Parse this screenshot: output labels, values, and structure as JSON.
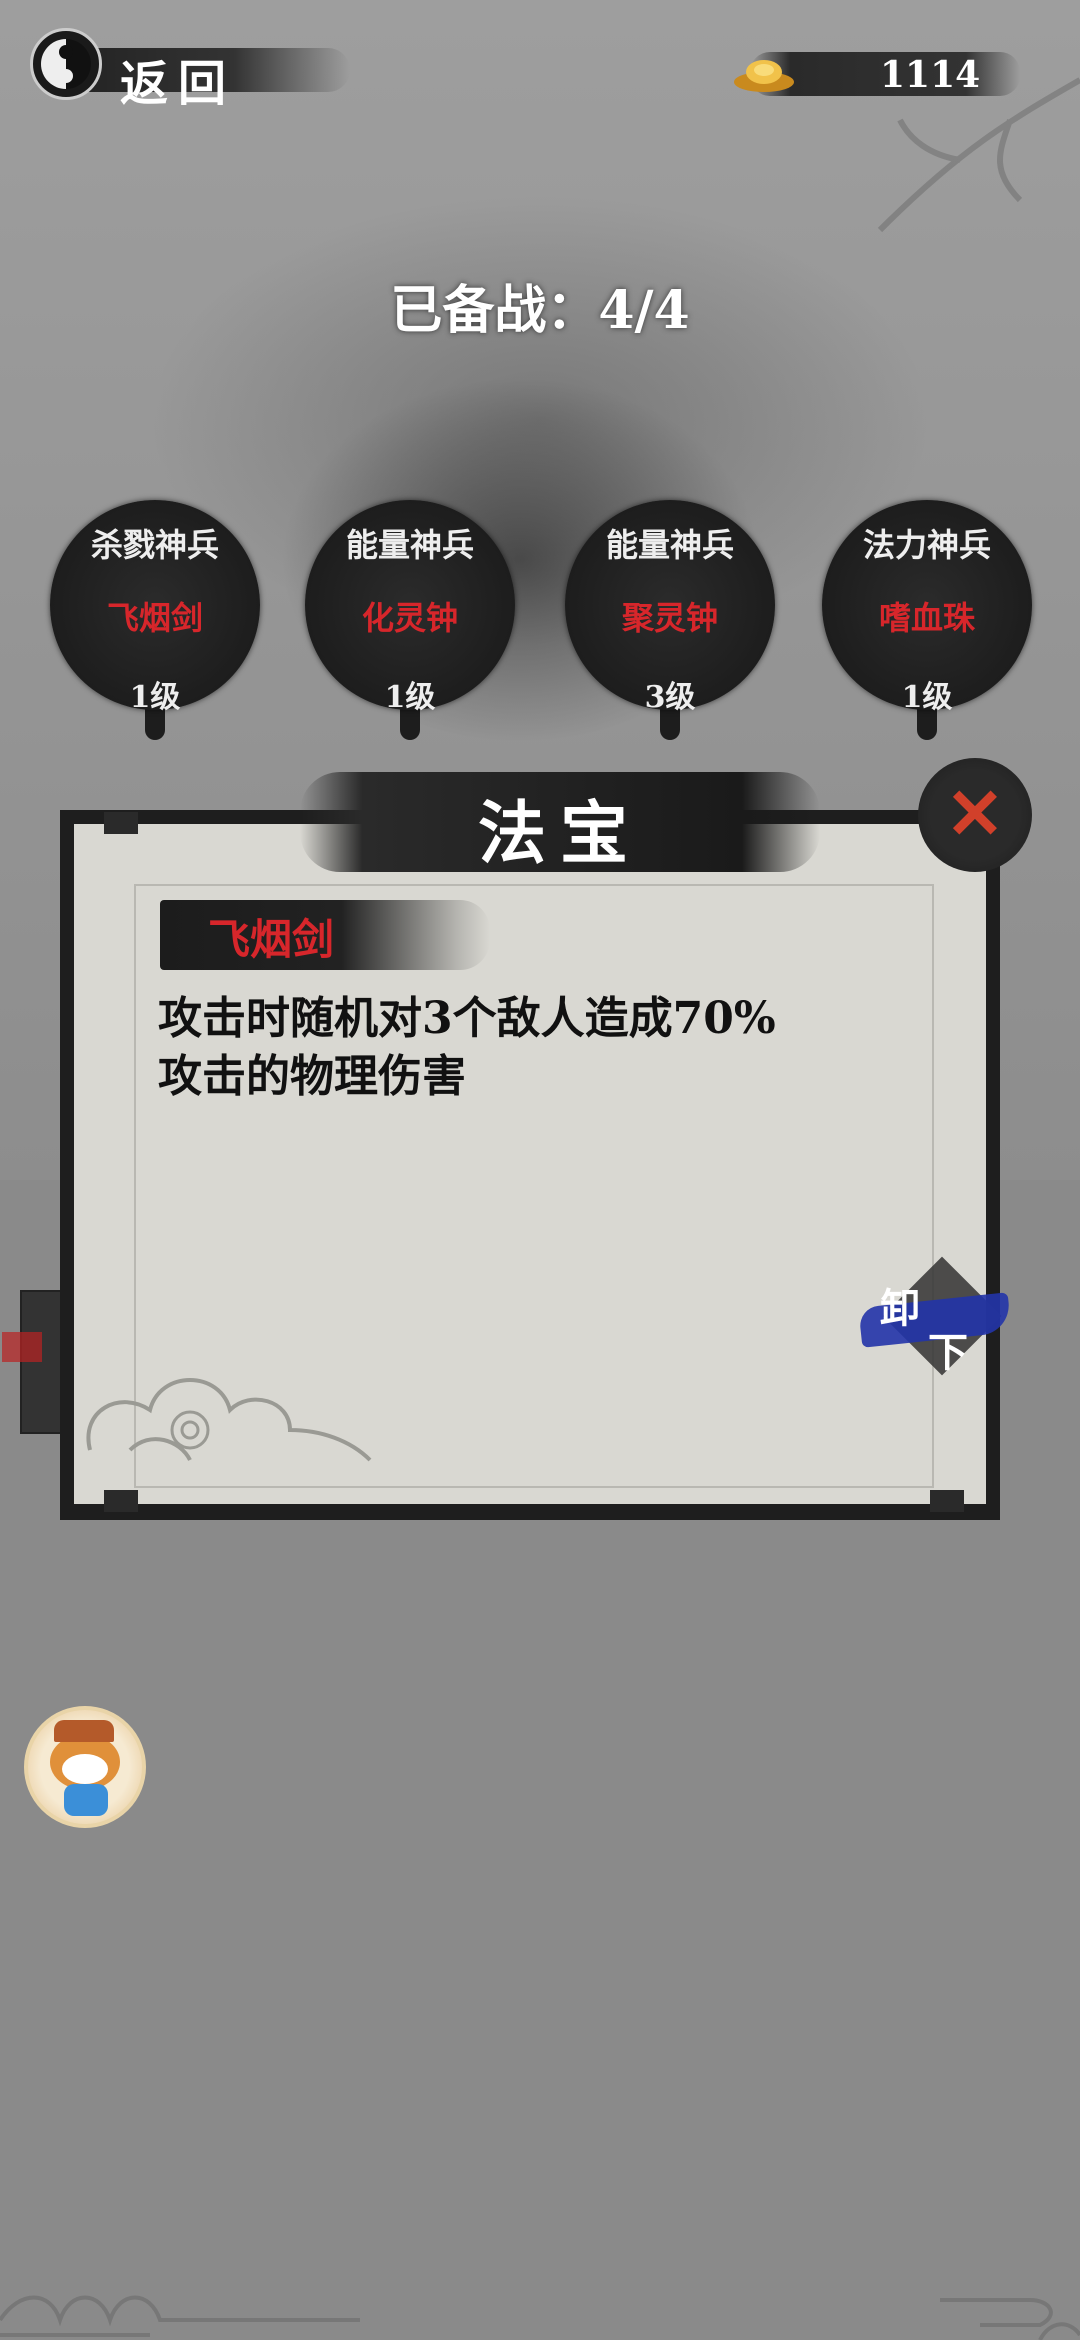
{
  "header": {
    "back_label": "返回",
    "gold_count": "1114"
  },
  "ready_status": "已备战：4/4",
  "slots": [
    {
      "type": "杀戮神兵",
      "name": "飞烟剑",
      "level": "1级"
    },
    {
      "type": "能量神兵",
      "name": "化灵钟",
      "level": "1级"
    },
    {
      "type": "能量神兵",
      "name": "聚灵钟",
      "level": "3级"
    },
    {
      "type": "法力神兵",
      "name": "嗜血珠",
      "level": "1级"
    }
  ],
  "dialog": {
    "title": "法宝",
    "item_name": "飞烟剑",
    "description_line1": "攻击时随机对3个敌人造成70%",
    "description_line2": "攻击的物理伤害",
    "unequip_char1": "卸",
    "unequip_char2": "下",
    "close_symbol": "✕"
  },
  "colors": {
    "accent_red": "#d7262b",
    "unequip_blue": "#2234a8",
    "paper": "#d9d8d2"
  }
}
